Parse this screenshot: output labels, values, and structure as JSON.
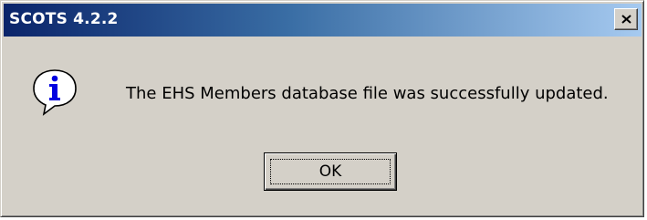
{
  "window": {
    "title": "SCOTS 4.2.2",
    "close_icon": "close-icon"
  },
  "message": {
    "icon": "info-icon",
    "text": "The EHS Members database file was successfully updated."
  },
  "buttons": {
    "ok_label": "OK"
  },
  "colors": {
    "title_gradient_start": "#0a246a",
    "title_gradient_end": "#a6caf0",
    "dialog_background": "#d4d0c8"
  }
}
